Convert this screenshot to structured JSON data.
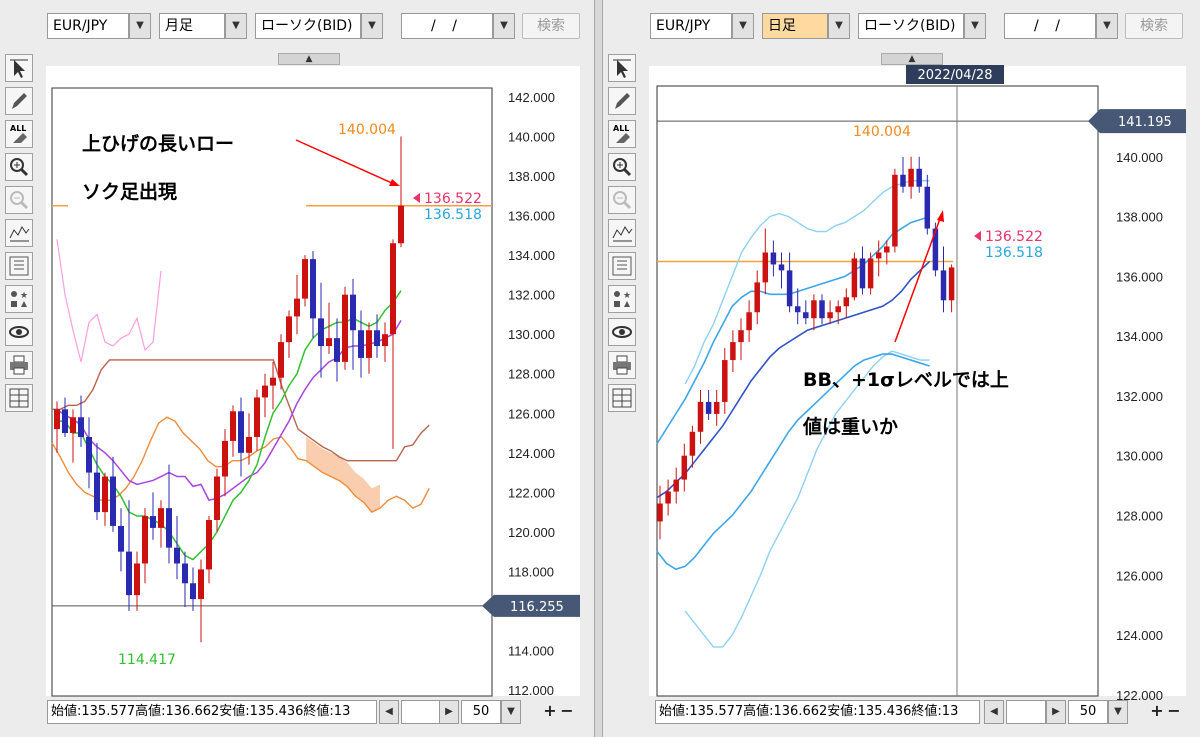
{
  "left": {
    "toolbar": {
      "pair": "EUR/JPY",
      "timeframe": "月足",
      "type": "ローソク(BID)",
      "date": "/ /",
      "search": "検索"
    },
    "ohlc_text": "始値:135.577高値:136.662安値:135.436終値:13",
    "count": "50",
    "annotation": [
      "上ひげの長いロー",
      "ソク足出現"
    ],
    "labels": {
      "high": "140.004",
      "low": "114.417",
      "price_bid": "136.522",
      "price_ask": "136.518",
      "cursor": "116.255"
    }
  },
  "right": {
    "toolbar": {
      "pair": "EUR/JPY",
      "timeframe": "日足",
      "type": "ローソク(BID)",
      "date": "/ /",
      "search": "検索"
    },
    "ohlc_text": "始値:135.577高値:136.662安値:135.436終値:13",
    "count": "50",
    "annotation": [
      "BB、+1σレベルでは上",
      "値は重いか"
    ],
    "labels": {
      "high": "140.004",
      "date": "2022/04/28",
      "price_bid": "136.522",
      "price_ask": "136.518",
      "cursor": "141.195"
    }
  },
  "colors": {
    "up": "#cc1111",
    "down": "#2a2ab0",
    "bid": "#e8336b",
    "ask": "#2ba7e0",
    "high": "#f08a1e",
    "low": "#2fc12f",
    "arrow": "#ff0000"
  },
  "chart_data": [
    {
      "type": "candlestick",
      "title": "EUR/JPY 月足",
      "ylim": [
        112,
        142
      ],
      "y_ticks": [
        "142.000",
        "140.000",
        "138.000",
        "136.000",
        "134.000",
        "132.000",
        "130.000",
        "128.000",
        "126.000",
        "124.000",
        "122.000",
        "120.000",
        "118.000",
        "116.000",
        "114.000",
        "112.000"
      ],
      "candles": [
        [
          125.2,
          126.6,
          124.0,
          126.2
        ],
        [
          126.2,
          126.8,
          124.8,
          125.0
        ],
        [
          125.0,
          126.2,
          123.5,
          125.8
        ],
        [
          125.8,
          126.9,
          124.3,
          124.8
        ],
        [
          124.8,
          125.8,
          122.2,
          123.0
        ],
        [
          123.0,
          124.5,
          120.6,
          121.0
        ],
        [
          121.0,
          123.0,
          120.3,
          122.8
        ],
        [
          122.8,
          123.8,
          120.0,
          120.3
        ],
        [
          120.3,
          121.2,
          118.0,
          119.0
        ],
        [
          119.0,
          121.6,
          116.0,
          116.8
        ],
        [
          116.8,
          119.0,
          116.0,
          118.4
        ],
        [
          118.4,
          121.2,
          117.4,
          120.8
        ],
        [
          120.8,
          122.0,
          119.6,
          120.2
        ],
        [
          120.2,
          121.6,
          119.2,
          121.2
        ],
        [
          121.2,
          123.4,
          118.4,
          119.2
        ],
        [
          119.2,
          120.8,
          117.6,
          118.4
        ],
        [
          118.4,
          119.0,
          116.2,
          117.4
        ],
        [
          117.4,
          118.2,
          116.0,
          116.6
        ],
        [
          116.6,
          118.6,
          114.417,
          118.1
        ],
        [
          118.1,
          120.8,
          117.4,
          120.6
        ],
        [
          120.6,
          123.2,
          120.0,
          122.8
        ],
        [
          122.8,
          125.2,
          121.8,
          124.6
        ],
        [
          124.6,
          126.4,
          123.8,
          126.1
        ],
        [
          126.1,
          126.8,
          122.8,
          124.0
        ],
        [
          124.0,
          126.0,
          123.4,
          124.8
        ],
        [
          124.8,
          127.2,
          124.1,
          126.8
        ],
        [
          126.8,
          128.0,
          125.8,
          127.4
        ],
        [
          127.4,
          128.6,
          126.2,
          127.8
        ],
        [
          127.8,
          130.0,
          127.2,
          129.6
        ],
        [
          129.6,
          131.2,
          128.8,
          130.9
        ],
        [
          130.9,
          133.0,
          130.0,
          131.8
        ],
        [
          131.8,
          134.0,
          131.4,
          133.8
        ],
        [
          133.8,
          134.2,
          129.8,
          130.8
        ],
        [
          130.8,
          132.6,
          127.8,
          129.4
        ],
        [
          129.4,
          131.6,
          129.0,
          129.8
        ],
        [
          129.8,
          130.8,
          127.6,
          128.6
        ],
        [
          128.6,
          132.4,
          128.2,
          132.0
        ],
        [
          132.0,
          132.8,
          128.2,
          130.2
        ],
        [
          130.2,
          131.2,
          127.8,
          128.8
        ],
        [
          128.8,
          130.6,
          128.0,
          130.2
        ],
        [
          130.2,
          131.0,
          128.8,
          129.4
        ],
        [
          129.4,
          130.6,
          128.6,
          130.0
        ],
        [
          130.0,
          134.8,
          124.2,
          134.6
        ],
        [
          134.6,
          140.004,
          134.4,
          136.5
        ]
      ],
      "last": [
        136.522,
        136.518
      ],
      "high_label": 140.004,
      "low_label": 114.417,
      "cursor": 116.255,
      "orange_hline": 136.5,
      "tenkan": [
        125.6,
        125.6,
        125.0,
        125.0,
        124.2,
        123.4,
        122.8,
        122.4,
        121.8,
        121.0,
        120.8,
        120.8,
        120.6,
        120.4,
        120.0,
        119.4,
        118.8,
        118.6,
        119.0,
        119.4,
        120.0,
        120.8,
        121.6,
        122.0,
        122.6,
        123.4,
        124.8,
        126.0,
        126.6,
        127.4,
        128.0,
        129.2,
        129.8,
        130.2,
        130.4,
        130.6,
        130.6,
        130.8,
        130.6,
        130.4,
        130.6,
        131.2,
        131.6,
        132.2
      ],
      "kijun": [
        126.2,
        125.9,
        125.7,
        125.4,
        124.7,
        124.3,
        124.0,
        123.6,
        123.1,
        122.6,
        122.4,
        122.5,
        122.6,
        122.8,
        123.0,
        122.8,
        122.8,
        122.3,
        122.4,
        121.6,
        121.7,
        121.9,
        122.2,
        122.5,
        122.8,
        123.0,
        123.5,
        124.2,
        124.9,
        125.6,
        126.5,
        127.2,
        127.8,
        128.2,
        128.6,
        128.8,
        129.3,
        129.4,
        129.4,
        129.5,
        129.6,
        129.8,
        130.0,
        130.7
      ],
      "senkou_a": [
        124.5,
        123.8,
        123.0,
        122.4,
        122.0,
        121.8,
        121.6,
        121.6,
        121.8,
        122.2,
        122.8,
        123.6,
        124.6,
        125.5,
        125.8,
        125.6,
        125.0,
        124.6,
        124.2,
        123.6,
        123.3,
        123.3,
        123.6,
        123.6,
        123.8,
        124.1,
        124.3,
        124.7,
        124.8,
        124.3,
        123.7,
        123.6,
        123.3,
        123.0,
        122.8,
        122.6,
        122.3,
        121.8,
        121.5,
        121.0,
        121.2,
        121.6,
        121.8,
        121.6,
        121.2,
        121.4,
        122.2
      ],
      "senkou_b": [
        126.2,
        126.2,
        126.4,
        126.4,
        126.6,
        127.2,
        128.2,
        128.7,
        128.7,
        128.7,
        128.7,
        128.7,
        128.7,
        128.7,
        128.7,
        128.7,
        128.7,
        128.7,
        128.7,
        128.7,
        128.7,
        128.7,
        128.7,
        128.7,
        128.7,
        128.7,
        128.7,
        128.7,
        127.4,
        126.3,
        125.2,
        124.9,
        124.6,
        124.3,
        124.1,
        123.8,
        123.6,
        123.6,
        123.6,
        123.6,
        123.6,
        123.6,
        123.6,
        124.3,
        124.4,
        125.0,
        125.4
      ],
      "chikou": [
        134.8,
        132.0,
        130.2,
        128.6,
        130.6,
        131.0,
        129.6,
        129.4,
        129.8,
        130.0,
        130.8,
        129.2,
        129.6,
        133.2
      ]
    },
    {
      "type": "candlestick",
      "title": "EUR/JPY 日足",
      "ylim": [
        121.96,
        142.37
      ],
      "y_ticks": [
        "140.000",
        "138.000",
        "136.000",
        "134.000",
        "132.000",
        "130.000",
        "128.000",
        "126.000",
        "124.000",
        "122.000"
      ],
      "candles": [
        [
          127.8,
          129.0,
          127.2,
          128.4
        ],
        [
          128.4,
          129.2,
          128.0,
          128.8
        ],
        [
          128.8,
          129.6,
          128.4,
          129.2
        ],
        [
          129.2,
          130.4,
          128.8,
          130.0
        ],
        [
          130.0,
          131.0,
          129.6,
          130.8
        ],
        [
          130.8,
          132.2,
          130.4,
          131.8
        ],
        [
          131.8,
          132.2,
          131.2,
          131.4
        ],
        [
          131.4,
          132.2,
          131.0,
          131.8
        ],
        [
          131.8,
          133.6,
          131.4,
          133.2
        ],
        [
          133.2,
          134.2,
          132.8,
          133.8
        ],
        [
          133.8,
          134.6,
          133.2,
          134.2
        ],
        [
          134.2,
          135.2,
          133.8,
          134.8
        ],
        [
          134.8,
          136.2,
          134.4,
          135.8
        ],
        [
          135.8,
          137.6,
          135.4,
          136.8
        ],
        [
          136.8,
          137.2,
          136.0,
          136.4
        ],
        [
          136.4,
          136.8,
          135.6,
          136.2
        ],
        [
          136.2,
          136.8,
          134.8,
          135.0
        ],
        [
          135.0,
          135.6,
          134.4,
          134.8
        ],
        [
          134.8,
          135.2,
          134.4,
          134.6
        ],
        [
          134.6,
          135.4,
          134.2,
          135.2
        ],
        [
          135.2,
          135.4,
          134.4,
          134.6
        ],
        [
          134.6,
          135.2,
          134.4,
          134.8
        ],
        [
          134.8,
          135.2,
          134.4,
          135.0
        ],
        [
          135.0,
          135.6,
          134.6,
          135.3
        ],
        [
          135.3,
          136.8,
          135.2,
          136.6
        ],
        [
          136.6,
          137.0,
          135.4,
          135.6
        ],
        [
          135.6,
          136.8,
          135.4,
          136.6
        ],
        [
          136.6,
          137.2,
          136.0,
          136.8
        ],
        [
          136.8,
          137.2,
          136.4,
          137.0
        ],
        [
          137.0,
          139.6,
          136.8,
          139.4
        ],
        [
          139.4,
          140.0,
          138.8,
          139.0
        ],
        [
          139.0,
          140.004,
          138.6,
          139.6
        ],
        [
          139.6,
          140.0,
          138.8,
          139.0
        ],
        [
          139.0,
          139.4,
          137.4,
          137.6
        ],
        [
          137.6,
          137.8,
          136.0,
          136.2
        ],
        [
          136.2,
          137.0,
          134.8,
          135.2
        ],
        [
          135.2,
          136.4,
          134.8,
          136.3
        ]
      ],
      "last": [
        136.522,
        136.518
      ],
      "high_label": 140.004,
      "cursor": 141.195,
      "date_label": "2022/04/28",
      "orange_hline": 136.5,
      "bb_mid": [
        128.6,
        128.8,
        129.1,
        129.4,
        129.8,
        130.2,
        130.6,
        131.0,
        131.5,
        132.0,
        132.5,
        132.9,
        133.3,
        133.6,
        133.8,
        134.0,
        134.2,
        134.3,
        134.4,
        134.5,
        134.6,
        134.7,
        134.8,
        134.9,
        135.0,
        135.2,
        135.5,
        135.9,
        136.2,
        136.5
      ],
      "bb_p1": [
        130.4,
        130.9,
        131.4,
        131.9,
        132.5,
        133.1,
        133.8,
        134.4,
        135.0,
        135.3,
        135.5,
        135.5,
        135.4,
        135.4,
        135.4,
        135.5,
        135.6,
        135.7,
        135.8,
        135.9,
        136.0,
        136.2,
        136.4,
        136.7,
        137.0,
        137.4,
        137.6,
        137.8,
        137.9,
        138.0
      ],
      "bb_p2": [
        132.4,
        133.0,
        133.8,
        134.4,
        135.2,
        136.0,
        136.8,
        137.3,
        137.7,
        138.0,
        138.1,
        138.0,
        137.8,
        137.6,
        137.5,
        137.5,
        137.7,
        137.8,
        138.0,
        138.2,
        138.5,
        138.8,
        139.0,
        139.1,
        139.2,
        139.2,
        139.2
      ],
      "bb_m1": [
        126.8,
        126.4,
        126.2,
        126.3,
        126.6,
        127.0,
        127.4,
        127.7,
        128.0,
        128.4,
        128.8,
        129.3,
        129.8,
        130.3,
        130.8,
        131.2,
        131.5,
        131.8,
        132.1,
        132.4,
        132.7,
        133.0,
        133.2,
        133.3,
        133.4,
        133.4,
        133.3,
        133.2,
        133.1,
        133.0
      ],
      "bb_m2": [
        124.8,
        124.4,
        124.0,
        123.6,
        123.6,
        124.0,
        124.6,
        125.3,
        126.0,
        126.8,
        127.4,
        128.0,
        128.6,
        129.4,
        130.2,
        130.8,
        131.4,
        131.8,
        132.2,
        132.6,
        133.0,
        133.3,
        133.5,
        133.4,
        133.3,
        133.2,
        133.2
      ]
    }
  ]
}
